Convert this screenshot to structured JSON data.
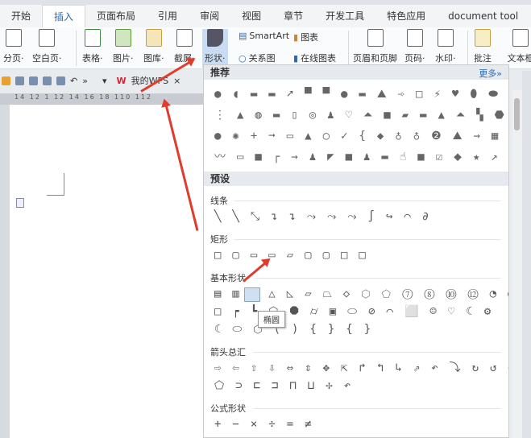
{
  "tabs": [
    "开始",
    "插入",
    "页面布局",
    "引用",
    "审阅",
    "视图",
    "章节",
    "开发工具",
    "特色应用",
    "document tool"
  ],
  "ribbon": {
    "fenye": "分页·",
    "kongbai": "空白页·",
    "biaoge": "表格·",
    "tupian": "图片·",
    "tuku": "图库·",
    "jieping": "截屏·",
    "xingzhuang": "形状·",
    "smartart": "SmartArt",
    "tubiao": "图表",
    "guanxitu": "关系图",
    "zaixian": "在线图表",
    "yemei": "页眉和页脚",
    "yema": "页码·",
    "shuiyin": "水印·",
    "pizhu": "批注",
    "wenben": "文本框"
  },
  "quickbar": {
    "wps_tab": "我的WPS",
    "close": "×"
  },
  "ruler": "14 12 1 12 14 16 18 110 112",
  "panel": {
    "recommended": "推荐",
    "more": "更多»",
    "preset": "预设",
    "rec_rows": [
      "●◖▬▬➚▀▀●▬⛰➾□⚡♥⬮⬬⚡",
      "⋮▲◍▬▯◎♟♡⏶■▰▬▲⏶▚⬣◕",
      "●✺+➞▭▲○✓{◆♁♁❷⛰→▦┼",
      "〰▭■┌→♟◤■♟▬☝■☑⬥★↗→"
    ],
    "categories": [
      {
        "name": "线条",
        "rows": [
          "╲╲⤡↴↴⤳⤳⤳∫↪⌒∂"
        ]
      },
      {
        "name": "矩形",
        "rows": [
          "□▢▭▭▱▢▢□□"
        ]
      },
      {
        "name": "基本形状",
        "rows": [
          "▤▥○△◺▱⏢◇⬡⬠⑦⑧⑩⑫◔◑◗",
          "□┍┗⬡⯃⌭▣⬭⊘⌒⬜☺♡☾⚙",
          "☾⬭⬡(){}{}"
        ]
      },
      {
        "name": "箭头总汇",
        "rows": [
          "⇨⇦⇧⇩⇔⇕✥⇱↱↰↳⇗↶⤵↻↺⇨",
          "⬠⊃⊏⊐⊓⊔✢↶"
        ]
      },
      {
        "name": "公式形状",
        "rows": [
          "+−×÷=≠"
        ]
      }
    ],
    "tooltip": "椭圆"
  }
}
